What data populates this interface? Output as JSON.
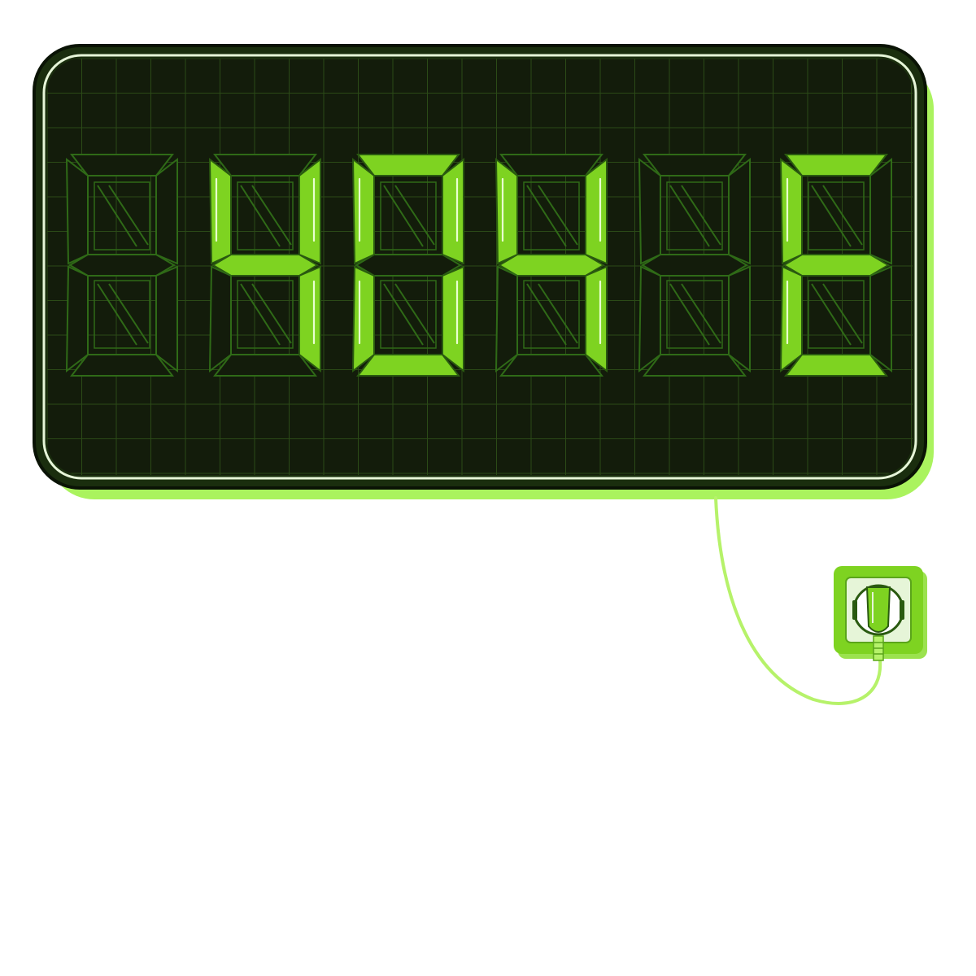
{
  "display": {
    "digits": [
      {
        "char": "",
        "lit": []
      },
      {
        "char": "4",
        "lit": [
          "b",
          "c",
          "f",
          "g"
        ]
      },
      {
        "char": "0",
        "lit": [
          "a",
          "b",
          "c",
          "d",
          "e",
          "f"
        ]
      },
      {
        "char": "4",
        "lit": [
          "b",
          "c",
          "f",
          "g"
        ]
      },
      {
        "char": "",
        "lit": []
      },
      {
        "char": "E",
        "lit": [
          "a",
          "d",
          "e",
          "f",
          "g"
        ]
      }
    ]
  },
  "colors": {
    "screen": "#131c0b",
    "frame_dark": "#1a2e0e",
    "frame_outline": "#0a1305",
    "glow": "#aaf35e",
    "segment_on": "#7ed321",
    "segment_off_stroke": "#2f6a17",
    "grid": "#2b4a17",
    "cable": "#b6f26a",
    "socket": "#7ed321"
  },
  "icons": {
    "socket": "wall-socket-icon",
    "plug": "power-plug-icon"
  }
}
